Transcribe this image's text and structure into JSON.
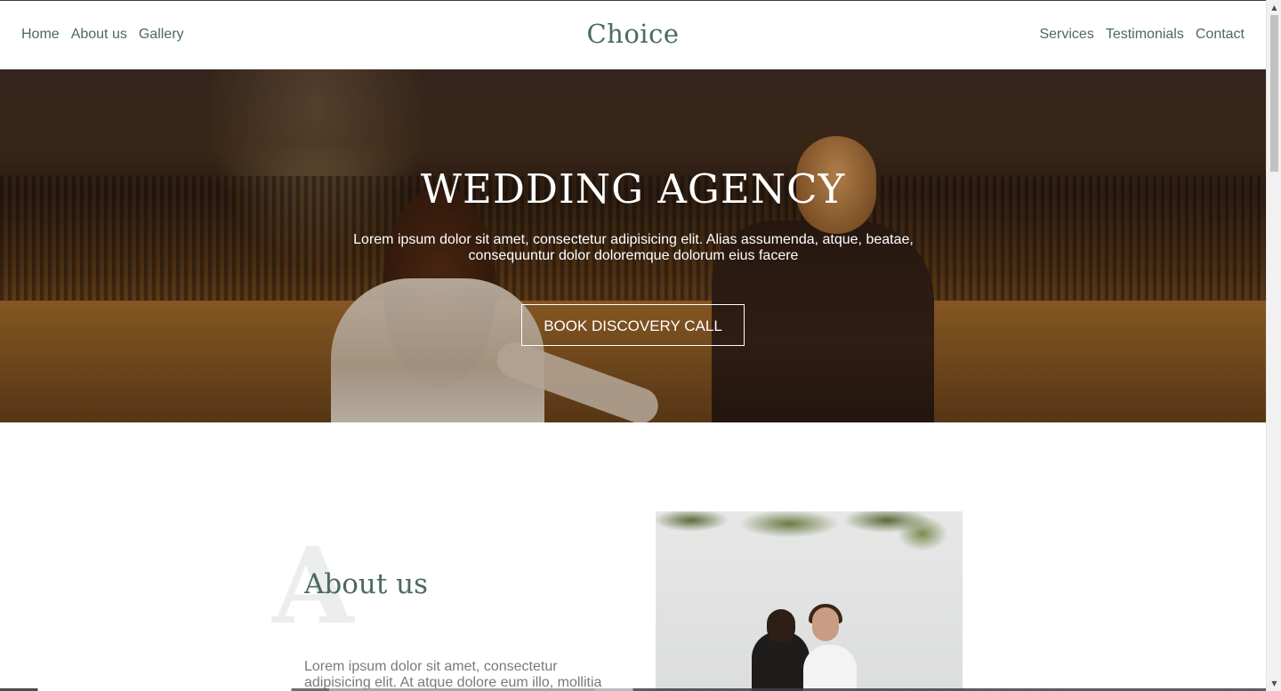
{
  "header": {
    "brand": "Choice",
    "nav_left": [
      "Home",
      "About us",
      "Gallery"
    ],
    "nav_right": [
      "Services",
      "Testimonials",
      "Contact"
    ]
  },
  "hero": {
    "title": "WEDDING AGENCY",
    "text": "Lorem ipsum dolor sit amet, consectetur adipisicing elit. Alias assumenda, atque, beatae, consequuntur dolor doloremque dolorum eius facere",
    "button_label": "BOOK DISCOVERY CALL"
  },
  "about": {
    "big_letter": "A",
    "title": "About us",
    "text": "Lorem ipsum dolor sit amet, consectetur adipisicing elit. At atque dolore eum illo, mollitia"
  },
  "colors": {
    "accent": "#4b6b5c",
    "body_text": "#7a7a7a",
    "hero_text": "#ffffff"
  },
  "icons": {
    "scroll_up": "scroll-up-arrow-icon",
    "scroll_down": "scroll-down-arrow-icon"
  }
}
